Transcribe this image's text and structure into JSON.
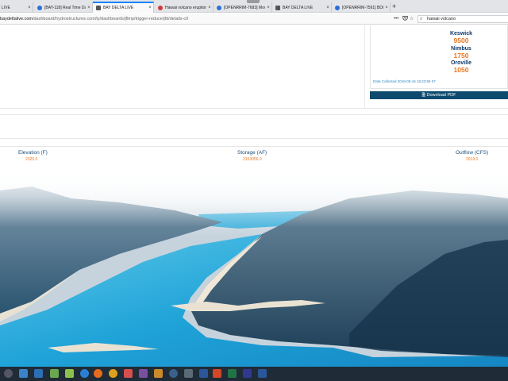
{
  "browser": {
    "tabs": [
      {
        "label": "LIVE",
        "fav": "#1a73e8"
      },
      {
        "label": "[BAY-118] Real Time Data - G...",
        "fav": "#2a6fdb"
      },
      {
        "label": "BAY DELTA LIVE",
        "fav": "#555555"
      },
      {
        "label": "Hawaii volcano eruption: Expl...",
        "fav": "#d23a3a"
      },
      {
        "label": "[OPENRRIM-7683] Move from...",
        "fav": "#2a6fdb"
      },
      {
        "label": "BAY DELTA LIVE",
        "fav": "#555555"
      },
      {
        "label": "[OPENRRIM-7591] BDL Open Li...",
        "fav": "#2a6fdb"
      }
    ],
    "new_tab": "+",
    "url_host": "baydeltalive.com",
    "url_path": "/dashboard/hydrostructures.com/ty/dashboards/jflmp/trigger-reduce/jfd/details-ctl",
    "search_value": "hawaii volcano",
    "icons": {
      "more": "•••",
      "bookmark": "☆",
      "search": "⌕"
    }
  },
  "page": {
    "reservoirs": [
      {
        "name": "Keswick",
        "value": "9500"
      },
      {
        "name": "Nimbus",
        "value": "1750"
      },
      {
        "name": "Oroville",
        "value": "1050"
      }
    ],
    "date_collected": "Data Collected 2018-05-16 15:23:55 07",
    "pdf_button": "Download PDF",
    "metrics": [
      {
        "label": "Elevation (F)",
        "value": "2325.0"
      },
      {
        "label": "Storage (AF)",
        "value": "3153056.0"
      },
      {
        "label": "Outflow (CFS)",
        "value": "2019.0"
      }
    ]
  },
  "colors": {
    "accent": "#e87722",
    "heading": "#1b4f7a",
    "button": "#0e4a6e"
  }
}
